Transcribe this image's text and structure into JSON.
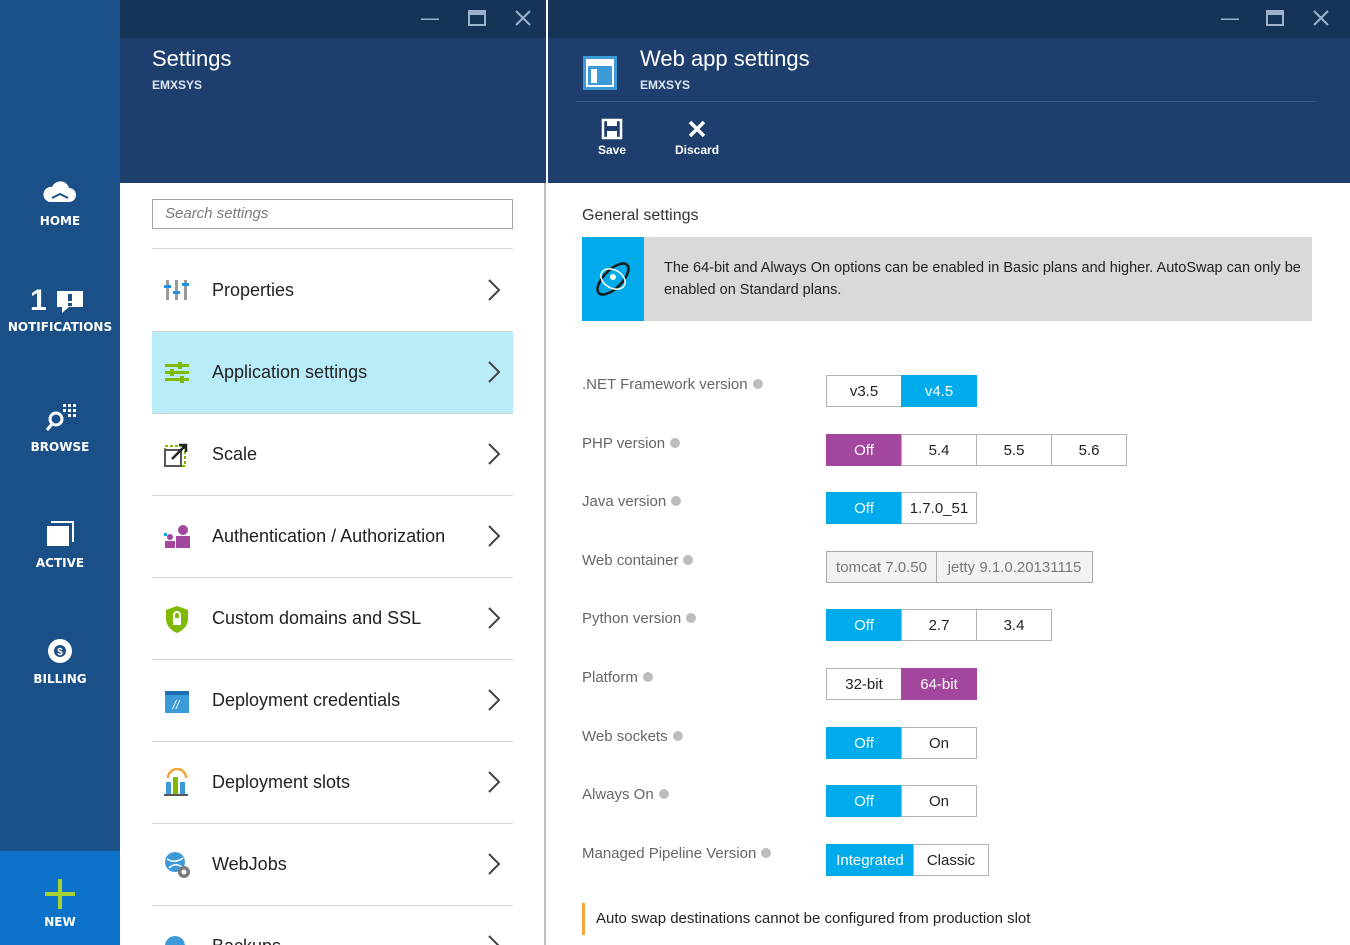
{
  "nav": {
    "home": "HOME",
    "notifications_count": "1",
    "notifications": "NOTIFICATIONS",
    "browse": "BROWSE",
    "active": "ACTIVE",
    "billing": "BILLING",
    "new": "NEW"
  },
  "settings_blade": {
    "title": "Settings",
    "subtitle": "EMXSYS",
    "search_placeholder": "Search settings",
    "items": [
      {
        "label": "Properties",
        "icon": "properties-icon"
      },
      {
        "label": "Application settings",
        "icon": "application-settings-icon",
        "selected": true
      },
      {
        "label": "Scale",
        "icon": "scale-icon"
      },
      {
        "label": "Authentication / Authorization",
        "icon": "authentication-icon"
      },
      {
        "label": "Custom domains and SSL",
        "icon": "shield-lock-icon"
      },
      {
        "label": "Deployment credentials",
        "icon": "credentials-icon"
      },
      {
        "label": "Deployment slots",
        "icon": "deployment-slots-icon"
      },
      {
        "label": "WebJobs",
        "icon": "webjobs-icon"
      },
      {
        "label": "Backups",
        "icon": "backups-icon"
      }
    ]
  },
  "webapp_blade": {
    "title": "Web app settings",
    "subtitle": "EMXSYS",
    "toolbar": {
      "save": "Save",
      "discard": "Discard"
    },
    "general_heading": "General settings",
    "banner_text": "The 64-bit and Always On options can be enabled in Basic plans and higher. AutoSwap can only be enabled on Standard plans.",
    "settings": [
      {
        "label": ".NET Framework version",
        "options": [
          "v3.5",
          "v4.5"
        ],
        "selected": "v4.5"
      },
      {
        "label": "PHP version",
        "options": [
          "Off",
          "5.4",
          "5.5",
          "5.6"
        ],
        "selected": "Off"
      },
      {
        "label": "Java version",
        "options": [
          "Off",
          "1.7.0_51"
        ],
        "selected": "Off"
      },
      {
        "label": "Web container",
        "options": [
          "tomcat 7.0.50",
          "jetty 9.1.0.20131115"
        ],
        "disabled": true
      },
      {
        "label": "Python version",
        "options": [
          "Off",
          "2.7",
          "3.4"
        ],
        "selected": "Off"
      },
      {
        "label": "Platform",
        "options": [
          "32-bit",
          "64-bit"
        ],
        "selected": "64-bit"
      },
      {
        "label": "Web sockets",
        "options": [
          "Off",
          "On"
        ],
        "selected": "Off"
      },
      {
        "label": "Always On",
        "options": [
          "Off",
          "On"
        ],
        "selected": "Off"
      },
      {
        "label": "Managed Pipeline Version",
        "options": [
          "Integrated",
          "Classic"
        ],
        "selected": "Integrated"
      }
    ],
    "warning": "Auto swap destinations cannot be configured from production slot"
  },
  "colors": {
    "nav_bg": "#1b4f87",
    "header_bg": "#1e3f6e",
    "accent_blue": "#00abec",
    "accent_purple": "#a2479d",
    "selected_row": "#b8ecf9",
    "new_bg": "#0d72c9"
  }
}
